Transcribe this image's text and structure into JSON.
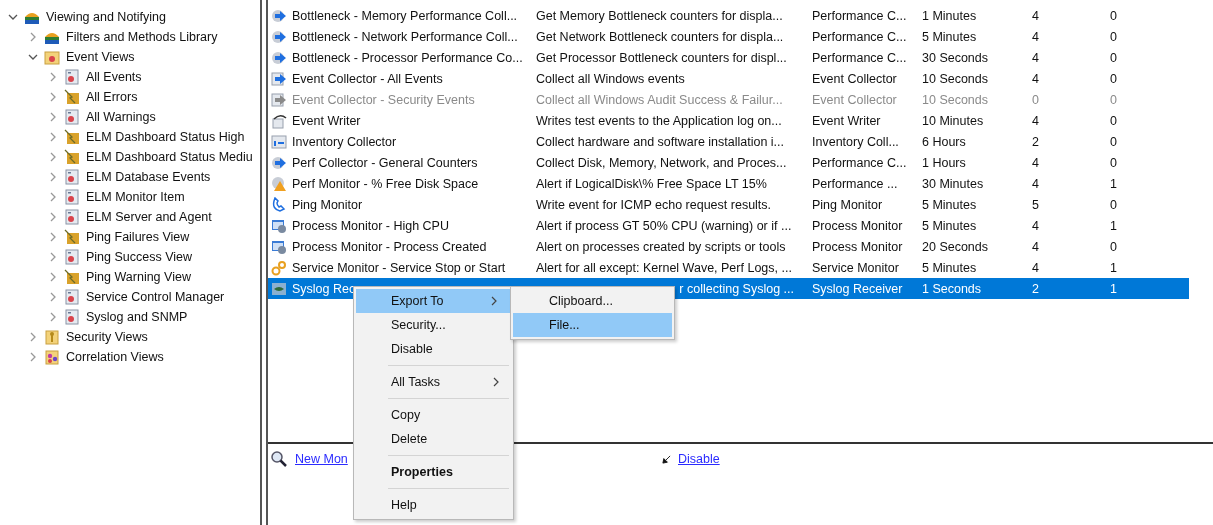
{
  "tree": [
    {
      "label": "Viewing and Notifying",
      "kind": "library",
      "expanded": true,
      "children": [
        {
          "label": "Filters and Methods Library",
          "kind": "library",
          "expanded": false
        },
        {
          "label": "Event Views",
          "kind": "eventfolder",
          "expanded": true,
          "children": [
            {
              "label": "All  Events",
              "kind": "view",
              "expanded": false
            },
            {
              "label": "All Errors",
              "kind": "filter",
              "expanded": false
            },
            {
              "label": "All Warnings",
              "kind": "view",
              "expanded": false
            },
            {
              "label": "ELM Dashboard Status High",
              "kind": "filter",
              "expanded": false
            },
            {
              "label": "ELM Dashboard Status Mediu",
              "kind": "filter",
              "expanded": false
            },
            {
              "label": "ELM Database Events",
              "kind": "view",
              "expanded": false
            },
            {
              "label": "ELM Monitor Item",
              "kind": "view",
              "expanded": false
            },
            {
              "label": "ELM Server and Agent",
              "kind": "view",
              "expanded": false
            },
            {
              "label": "Ping Failures View",
              "kind": "filter",
              "expanded": false
            },
            {
              "label": "Ping Success View",
              "kind": "view",
              "expanded": false
            },
            {
              "label": "Ping Warning View",
              "kind": "filter",
              "expanded": false
            },
            {
              "label": "Service Control Manager",
              "kind": "view",
              "expanded": false
            },
            {
              "label": "Syslog and SNMP",
              "kind": "view",
              "expanded": false
            }
          ]
        },
        {
          "label": "Security Views",
          "kind": "key",
          "expanded": false
        },
        {
          "label": "Correlation Views",
          "kind": "correlation",
          "expanded": false
        }
      ]
    }
  ],
  "monitors": {
    "rows": [
      {
        "kind": "arrow",
        "name": "Bottleneck - Memory Performance Coll...",
        "description": "Get Memory Bottleneck counters for displa...",
        "column_3": "Performance C...",
        "column_4": "1 Minutes",
        "column_5": "4",
        "column_6": "0",
        "disabled": false,
        "selected": false
      },
      {
        "kind": "arrow",
        "name": "Bottleneck - Network Performance Coll...",
        "description": "Get Network Bottleneck counters for displa...",
        "column_3": "Performance C...",
        "column_4": "5 Minutes",
        "column_5": "4",
        "column_6": "0",
        "disabled": false,
        "selected": false
      },
      {
        "kind": "arrow",
        "name": "Bottleneck - Processor Performance Co...",
        "description": "Get Processor Bottleneck counters for displ...",
        "column_3": "Performance C...",
        "column_4": "30 Seconds",
        "column_5": "4",
        "column_6": "0",
        "disabled": false,
        "selected": false
      },
      {
        "kind": "collector",
        "name": "Event Collector - All Events",
        "description": "Collect all Windows events",
        "column_3": "Event Collector",
        "column_4": "10 Seconds",
        "column_5": "4",
        "column_6": "0",
        "disabled": false,
        "selected": false
      },
      {
        "kind": "collector",
        "name": "Event Collector - Security Events",
        "description": "Collect all Windows Audit Success & Failur...",
        "column_3": "Event Collector",
        "column_4": "10 Seconds",
        "column_5": "0",
        "column_6": "0",
        "disabled": true,
        "selected": false
      },
      {
        "kind": "writer",
        "name": "Event Writer",
        "description": "Writes test events to the Application log on...",
        "column_3": "Event Writer",
        "column_4": "10 Minutes",
        "column_5": "4",
        "column_6": "0",
        "disabled": false,
        "selected": false
      },
      {
        "kind": "inventory",
        "name": "Inventory Collector",
        "description": "Collect hardware and software installation i...",
        "column_3": "Inventory Coll...",
        "column_4": "6 Hours",
        "column_5": "2",
        "column_6": "0",
        "disabled": false,
        "selected": false
      },
      {
        "kind": "arrow",
        "name": "Perf Collector - General Counters",
        "description": "Collect Disk, Memory, Network, and Proces...",
        "column_3": "Performance C...",
        "column_4": "1 Hours",
        "column_5": "4",
        "column_6": "0",
        "disabled": false,
        "selected": false
      },
      {
        "kind": "warning",
        "name": "Perf Monitor - % Free Disk Space",
        "description": "Alert if LogicalDisk\\% Free Space LT 15%",
        "column_3": "Performance ...",
        "column_4": "30 Minutes",
        "column_5": "4",
        "column_6": "1",
        "disabled": false,
        "selected": false
      },
      {
        "kind": "ping",
        "name": "Ping Monitor",
        "description": "Write event for ICMP echo request results.",
        "column_3": "Ping Monitor",
        "column_4": "5 Minutes",
        "column_5": "5",
        "column_6": "0",
        "disabled": false,
        "selected": false
      },
      {
        "kind": "process",
        "name": "Process Monitor - High CPU",
        "description": "Alert if process GT 50% CPU (warning) or if ...",
        "column_3": "Process Monitor",
        "column_4": "5 Minutes",
        "column_5": "4",
        "column_6": "1",
        "disabled": false,
        "selected": false
      },
      {
        "kind": "process",
        "name": "Process Monitor - Process Created",
        "description": "Alert on processes created by scripts or tools",
        "column_3": "Process Monitor",
        "column_4": "20 Seconds",
        "column_5": "4",
        "column_6": "0",
        "disabled": false,
        "selected": false
      },
      {
        "kind": "service",
        "name": "Service Monitor - Service Stop or Start",
        "description": "Alert for all except: Kernel Wave, Perf Logs, ...",
        "column_3": "Service Monitor",
        "column_4": "5 Minutes",
        "column_5": "4",
        "column_6": "1",
        "disabled": false,
        "selected": false
      },
      {
        "kind": "syslog",
        "name": "Syslog Rec",
        "description": "r collecting Syslog ...",
        "column_3": "Syslog Receiver",
        "column_4": "1 Seconds",
        "column_5": "2",
        "column_6": "1",
        "disabled": false,
        "selected": true
      }
    ]
  },
  "tasks": [
    {
      "label": "New Mon",
      "kind": "magnifier"
    },
    {
      "label": "Disable",
      "kind": "arrow"
    }
  ],
  "context_menu": {
    "items": [
      {
        "kind": "item",
        "label": "Export To",
        "submenu": true,
        "bold": false,
        "selected": true
      },
      {
        "kind": "item",
        "label": "Security...",
        "submenu": false,
        "bold": false,
        "selected": false
      },
      {
        "kind": "item",
        "label": "Disable",
        "submenu": false,
        "bold": false,
        "selected": false
      },
      {
        "kind": "separator"
      },
      {
        "kind": "item",
        "label": "All Tasks",
        "submenu": true,
        "bold": false,
        "selected": false
      },
      {
        "kind": "separator"
      },
      {
        "kind": "item",
        "label": "Copy",
        "submenu": false,
        "bold": false,
        "selected": false
      },
      {
        "kind": "item",
        "label": "Delete",
        "submenu": false,
        "bold": false,
        "selected": false
      },
      {
        "kind": "separator"
      },
      {
        "kind": "item",
        "label": "Properties",
        "submenu": false,
        "bold": true,
        "selected": false
      },
      {
        "kind": "separator"
      },
      {
        "kind": "item",
        "label": "Help",
        "submenu": false,
        "bold": false,
        "selected": false
      }
    ],
    "submenu": [
      {
        "label": "Clipboard...",
        "selected": false
      },
      {
        "label": "File...",
        "selected": true
      }
    ]
  }
}
